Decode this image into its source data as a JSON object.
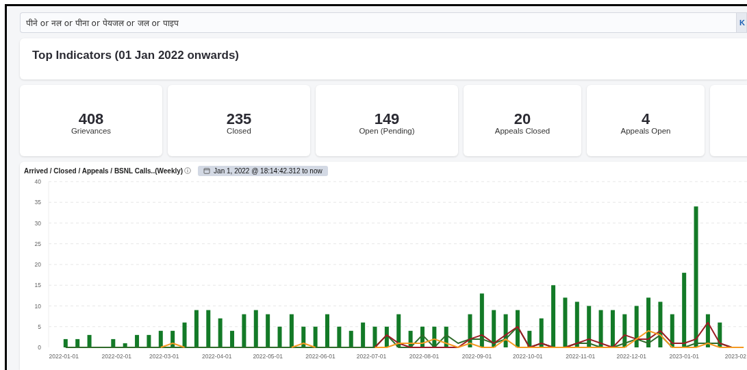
{
  "search": {
    "value": "पीने or नल or पीना or पेयजल or जल or पाइप",
    "button": "K"
  },
  "indicators": {
    "title": "Top Indicators (01 Jan 2022 onwards)"
  },
  "stats": [
    {
      "value": "408",
      "label": "Grievances"
    },
    {
      "value": "235",
      "label": "Closed"
    },
    {
      "value": "149",
      "label": "Open (Pending)"
    },
    {
      "value": "20",
      "label": "Appeals Closed"
    },
    {
      "value": "4",
      "label": "Appeals Open"
    }
  ],
  "chart": {
    "title": "Arrived / Closed / Appeals / BSNL Calls..(Weekly)",
    "range": "Jan 1, 2022 @ 18:14:42.312 to now",
    "chart_data": {
      "type": "bar",
      "x": [
        "2022-01-02",
        "2022-01-09",
        "2022-01-16",
        "2022-01-23",
        "2022-01-30",
        "2022-02-06",
        "2022-02-13",
        "2022-02-20",
        "2022-02-27",
        "2022-03-06",
        "2022-03-13",
        "2022-03-20",
        "2022-03-27",
        "2022-04-03",
        "2022-04-10",
        "2022-04-17",
        "2022-04-24",
        "2022-05-01",
        "2022-05-08",
        "2022-05-15",
        "2022-05-22",
        "2022-05-29",
        "2022-06-05",
        "2022-06-12",
        "2022-06-19",
        "2022-06-26",
        "2022-07-03",
        "2022-07-10",
        "2022-07-17",
        "2022-07-24",
        "2022-07-31",
        "2022-08-07",
        "2022-08-14",
        "2022-08-21",
        "2022-08-28",
        "2022-09-04",
        "2022-09-11",
        "2022-09-18",
        "2022-09-25",
        "2022-10-02",
        "2022-10-09",
        "2022-10-16",
        "2022-10-23",
        "2022-10-30",
        "2022-11-06",
        "2022-11-13",
        "2022-11-20",
        "2022-11-27",
        "2022-12-04",
        "2022-12-11",
        "2022-12-18",
        "2022-12-25",
        "2023-01-01",
        "2023-01-08",
        "2023-01-15",
        "2023-01-22",
        "2023-01-29",
        "2023-02-05"
      ],
      "series": [
        {
          "color": "#137a27",
          "values": [
            2,
            2,
            3,
            0,
            2,
            1,
            3,
            3,
            4,
            4,
            6,
            9,
            9,
            7,
            4,
            8,
            9,
            8,
            5,
            8,
            5,
            5,
            8,
            5,
            4,
            6,
            5,
            5,
            8,
            4,
            5,
            5,
            5,
            0,
            8,
            13,
            9,
            8,
            9,
            4,
            7,
            15,
            12,
            11,
            10,
            9,
            9,
            8,
            10,
            12,
            11,
            8,
            18,
            34,
            8,
            6,
            0,
            0
          ]
        },
        {
          "type": "line",
          "color": "#f59a23",
          "values": [
            null,
            null,
            null,
            null,
            null,
            null,
            null,
            null,
            0,
            1,
            0,
            null,
            null,
            null,
            null,
            null,
            null,
            null,
            null,
            0,
            1,
            0,
            null,
            null,
            null,
            null,
            0,
            0,
            1,
            1,
            1,
            2,
            1,
            0,
            1,
            0,
            0,
            2,
            0,
            0,
            0,
            0,
            0,
            0,
            0,
            0,
            0,
            0,
            2,
            4,
            3,
            0,
            0,
            0,
            1,
            0,
            0,
            0
          ]
        },
        {
          "type": "line",
          "color": "#9b1c24",
          "values": [
            null,
            null,
            null,
            null,
            null,
            null,
            null,
            null,
            null,
            null,
            null,
            null,
            null,
            null,
            null,
            null,
            null,
            null,
            null,
            null,
            null,
            null,
            null,
            null,
            null,
            null,
            0,
            3,
            1,
            0,
            0,
            0,
            0,
            0,
            2,
            3,
            1,
            3,
            5,
            0,
            1,
            0,
            0,
            1,
            2,
            1,
            0,
            3,
            2,
            2,
            4,
            1,
            1,
            2,
            6,
            1,
            0,
            0
          ]
        },
        {
          "type": "line",
          "color": "#2f6b2a",
          "values": [
            0,
            0,
            0,
            0,
            0,
            0,
            0,
            0,
            0,
            0,
            0,
            0,
            0,
            0,
            0,
            0,
            0,
            0,
            0,
            0,
            0,
            0,
            0,
            0,
            0,
            0,
            0,
            3,
            0,
            0,
            3,
            0,
            3,
            1,
            2,
            2,
            1,
            2,
            5,
            0,
            1,
            0,
            0,
            1,
            1,
            0,
            0,
            1,
            2,
            1,
            3,
            0,
            0,
            1,
            1,
            1,
            0,
            0
          ]
        }
      ],
      "xlim": [
        "2021-12-23",
        "2023-02-07"
      ],
      "ylim": [
        0,
        40
      ],
      "grid": true,
      "yticks": [
        0,
        5,
        10,
        15,
        20,
        25,
        30,
        35,
        40
      ],
      "xticks": [
        {
          "value": "2022-01-01",
          "label": "2022-01-01"
        },
        {
          "value": "2022-02-01",
          "label": "2022-02-01"
        },
        {
          "value": "2022-03-01",
          "label": "2022-03-01"
        },
        {
          "value": "2022-04-01",
          "label": "2022-04-01"
        },
        {
          "value": "2022-05-01",
          "label": "2022-05-01"
        },
        {
          "value": "2022-06-01",
          "label": "2022-06-01"
        },
        {
          "value": "2022-07-01",
          "label": "2022-07-01"
        },
        {
          "value": "2022-08-01",
          "label": "2022-08-01"
        },
        {
          "value": "2022-09-01",
          "label": "2022-09-01"
        },
        {
          "value": "2022-10-01",
          "label": "2022-10-01"
        },
        {
          "value": "2022-11-01",
          "label": "2022-11-01"
        },
        {
          "value": "2022-12-01",
          "label": "2022-12-01"
        },
        {
          "value": "2023-01-01",
          "label": "2023-01-01"
        },
        {
          "value": "2023-02-01",
          "label": "2023-02"
        }
      ]
    }
  }
}
